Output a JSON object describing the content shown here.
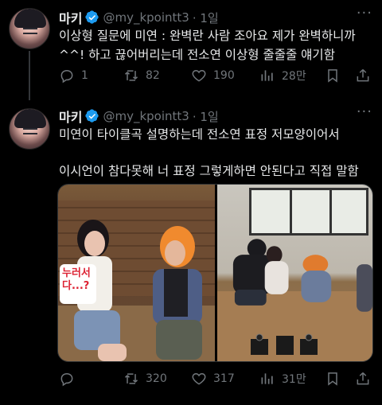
{
  "tweets": [
    {
      "author_name": "마키",
      "handle": "@my_kpointt3",
      "time": "· 1일",
      "text_lines": [
        "이상형 질문에 미연 : 완벽란 사람 조아요 제가 완벽하니까",
        "^^! 하고 끊어버리는데 전소연 이상형 줄줄줄 얘기함"
      ],
      "replies": "1",
      "retweets": "82",
      "likes": "190",
      "views": "28만"
    },
    {
      "author_name": "마키",
      "handle": "@my_kpointt3",
      "time": "· 1일",
      "text_lines": [
        "미연이 타이클곡 설명하는데 전소연 표정 저모양이어서",
        "",
        "이시언이 참다못해 너 표정 그렇게하면 안된다고 직접 말함"
      ],
      "media_caption": "누러서 다...?",
      "replies": "",
      "retweets": "320",
      "likes": "317",
      "views": "31만"
    }
  ],
  "icons": {
    "verified": "verified-badge-icon",
    "more": "more-icon",
    "reply": "reply-icon",
    "retweet": "retweet-icon",
    "like": "heart-icon",
    "views": "views-icon",
    "bookmark": "bookmark-icon",
    "share": "share-icon"
  },
  "colors": {
    "verified_blue": "#1d9bf0",
    "muted": "#71767b",
    "text": "#e7e9ea"
  }
}
